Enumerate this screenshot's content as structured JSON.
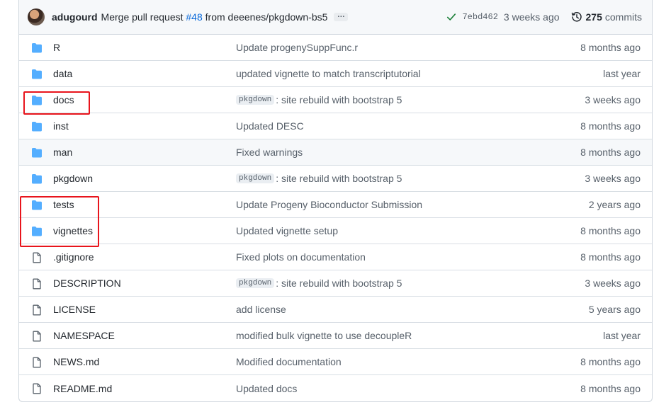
{
  "commit": {
    "author": "adugourd",
    "message_prefix": "Merge pull request ",
    "pr": "#48",
    "message_suffix": " from deeenes/pkgdown-bs5",
    "ellipsis": "…",
    "sha": "7ebd462",
    "time": "3 weeks ago",
    "count": "275",
    "count_label": "commits"
  },
  "files": [
    {
      "type": "folder",
      "name": "R",
      "commit_tag": "",
      "commit": "Update progenySuppFunc.r",
      "age": "8 months ago"
    },
    {
      "type": "folder",
      "name": "data",
      "commit_tag": "",
      "commit": "updated vignette to match transcriptutorial",
      "age": "last year"
    },
    {
      "type": "folder",
      "name": "docs",
      "commit_tag": "pkgdown",
      "commit": ": site rebuild with bootstrap 5",
      "age": "3 weeks ago"
    },
    {
      "type": "folder",
      "name": "inst",
      "commit_tag": "",
      "commit": "Updated DESC",
      "age": "8 months ago"
    },
    {
      "type": "folder",
      "name": "man",
      "commit_tag": "",
      "commit": "Fixed warnings",
      "age": "8 months ago"
    },
    {
      "type": "folder",
      "name": "pkgdown",
      "commit_tag": "pkgdown",
      "commit": ": site rebuild with bootstrap 5",
      "age": "3 weeks ago"
    },
    {
      "type": "folder",
      "name": "tests",
      "commit_tag": "",
      "commit": "Update Progeny Bioconductor Submission",
      "age": "2 years ago"
    },
    {
      "type": "folder",
      "name": "vignettes",
      "commit_tag": "",
      "commit": "Updated vignette setup",
      "age": "8 months ago"
    },
    {
      "type": "file",
      "name": ".gitignore",
      "commit_tag": "",
      "commit": "Fixed plots on documentation",
      "age": "8 months ago"
    },
    {
      "type": "file",
      "name": "DESCRIPTION",
      "commit_tag": "pkgdown",
      "commit": ": site rebuild with bootstrap 5",
      "age": "3 weeks ago"
    },
    {
      "type": "file",
      "name": "LICENSE",
      "commit_tag": "",
      "commit": "add license",
      "age": "5 years ago"
    },
    {
      "type": "file",
      "name": "NAMESPACE",
      "commit_tag": "",
      "commit": "modified bulk vignette to use decoupleR",
      "age": "last year"
    },
    {
      "type": "file",
      "name": "NEWS.md",
      "commit_tag": "",
      "commit": "Modified documentation",
      "age": "8 months ago"
    },
    {
      "type": "file",
      "name": "README.md",
      "commit_tag": "",
      "commit": "Updated docs",
      "age": "8 months ago"
    }
  ],
  "colors": {
    "folder": "#54aeff",
    "file_icon": "#57606a",
    "check": "#1a7f37",
    "highlight": "#e8141c",
    "link": "#0969da"
  }
}
